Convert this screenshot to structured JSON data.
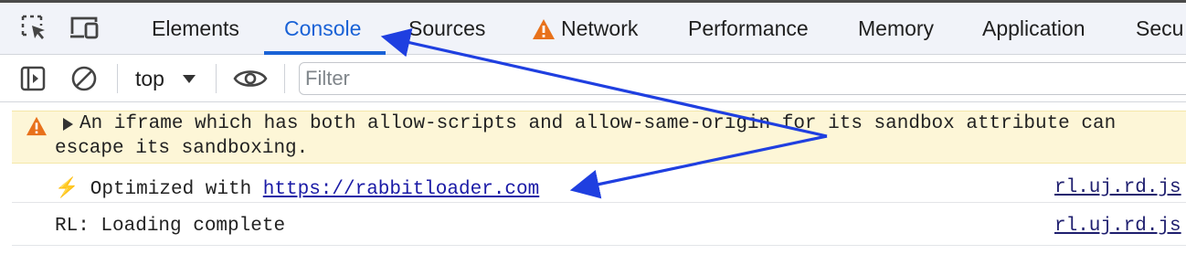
{
  "tabs": [
    {
      "label": "Elements",
      "active": false
    },
    {
      "label": "Console",
      "active": true
    },
    {
      "label": "Sources",
      "active": false
    },
    {
      "label": "Network",
      "active": false,
      "warning": true
    },
    {
      "label": "Performance",
      "active": false
    },
    {
      "label": "Memory",
      "active": false
    },
    {
      "label": "Application",
      "active": false
    },
    {
      "label": "Secu",
      "active": false
    }
  ],
  "toolbar": {
    "context": "top",
    "filter_placeholder": "Filter"
  },
  "messages": {
    "warning": {
      "line1": "An iframe which has both allow-scripts and allow-same-origin for its sandbox attribute can",
      "line2": "escape its sandboxing."
    },
    "log1": {
      "prefix": "⚡ Optimized with ",
      "url": "https://rabbitloader.com",
      "source": "rl.uj.rd.js"
    },
    "log2": {
      "text": "RL: Loading complete",
      "source": "rl.uj.rd.js"
    }
  },
  "colors": {
    "accent": "#1a62d6",
    "annotation_arrow": "#1f3fe0",
    "warning_bg": "#fdf6d7",
    "warning_icon": "#e8711b"
  }
}
